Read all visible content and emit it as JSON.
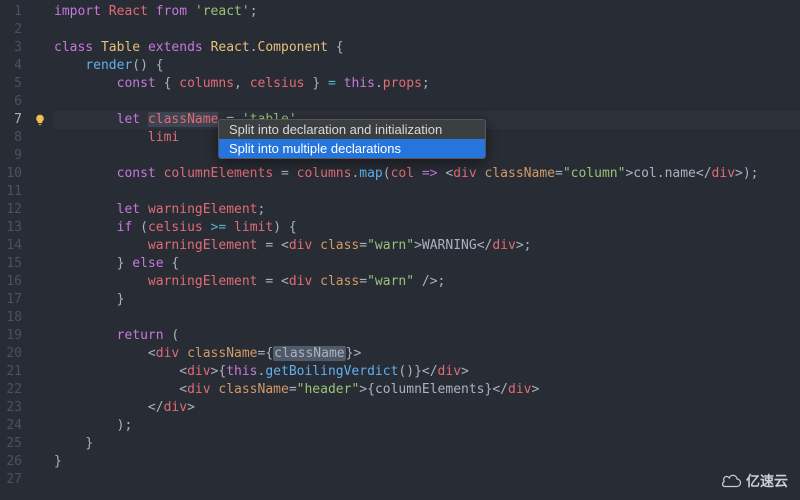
{
  "line_count": 27,
  "active_line": 7,
  "bulb_line": 7,
  "popup": {
    "items": [
      {
        "label": "Split into declaration and initialization",
        "selected": false
      },
      {
        "label": "Split into multiple declarations",
        "selected": true
      }
    ]
  },
  "watermark": "亿速云",
  "code": {
    "l1": {
      "kw1": "import",
      "id": "React",
      "kw2": "from",
      "str": "'react'",
      "end": ";"
    },
    "l3": {
      "kw1": "class",
      "cls1": "Table",
      "kw2": "extends",
      "cls2": "React",
      "dot": ".",
      "cls3": "Component",
      "brace": " {"
    },
    "l4": {
      "fn": "render",
      "rest": "() {"
    },
    "l5": {
      "kw": "const",
      "b1": " { ",
      "v1": "columns",
      "c": ", ",
      "v2": "celsius",
      "b2": " } ",
      "eq": "=",
      "th": " this",
      "dot": ".",
      "p": "props",
      "end": ";"
    },
    "l7": {
      "kw": "let",
      "v": "className",
      "eq": " = ",
      "str": "'table'",
      "end": ","
    },
    "l8": {
      "v": "limi"
    },
    "l10": {
      "kw": "const",
      "v": "columnElements",
      "eq": " = ",
      "obj": "columns",
      "dot": ".",
      "fn": "map",
      "p1": "(",
      "arg": "col",
      "arr": " => ",
      "t1": "<",
      "tag": "div",
      "sp": " ",
      "attr": "className",
      "aq": "=",
      "str": "\"column\"",
      "t2": ">",
      "expr": "col.name",
      "t3": "</",
      "tag2": "div",
      "t4": ">",
      "end": ");"
    },
    "l12": {
      "kw": "let",
      "v": "warningElement",
      "end": ";"
    },
    "l13": {
      "kw": "if",
      "p": " (",
      "v1": "celsius",
      "op": " >= ",
      "v2": "limit",
      "p2": ") {"
    },
    "l14": {
      "v": "warningElement",
      "eq": " = ",
      "t1": "<",
      "tag": "div",
      "sp": " ",
      "attr": "class",
      "aq": "=",
      "str": "\"warn\"",
      "t2": ">",
      "txt": "WARNING",
      "t3": "</",
      "tag2": "div",
      "t4": ">",
      "end": ";"
    },
    "l15": {
      "b": "} ",
      "kw": "else",
      "b2": " {"
    },
    "l16": {
      "v": "warningElement",
      "eq": " = ",
      "t1": "<",
      "tag": "div",
      "sp": " ",
      "attr": "class",
      "aq": "=",
      "str": "\"warn\"",
      "t2": " />",
      "end": ";"
    },
    "l17": {
      "b": "}"
    },
    "l19": {
      "kw": "return",
      "p": " ("
    },
    "l20": {
      "t1": "<",
      "tag": "div",
      "sp": " ",
      "attr": "className",
      "aq": "=",
      "b1": "{",
      "expr": "className",
      "b2": "}",
      "t2": ">"
    },
    "l21": {
      "t1": "<",
      "tag": "div",
      "t2": ">",
      "b1": "{",
      "th": "this",
      "dot": ".",
      "fn": "getBoilingVerdict",
      "call": "()",
      "b2": "}",
      "t3": "</",
      "tag2": "div",
      "t4": ">"
    },
    "l22": {
      "t1": "<",
      "tag": "div",
      "sp": " ",
      "attr": "className",
      "aq": "=",
      "str": "\"header\"",
      "t2": ">",
      "b1": "{",
      "expr": "columnElements",
      "b2": "}",
      "t3": "</",
      "tag2": "div",
      "t4": ">"
    },
    "l23": {
      "t1": "</",
      "tag": "div",
      "t2": ">"
    },
    "l24": {
      "p": ");"
    },
    "l25": {
      "b": "}"
    },
    "l26": {
      "b": "}"
    }
  }
}
